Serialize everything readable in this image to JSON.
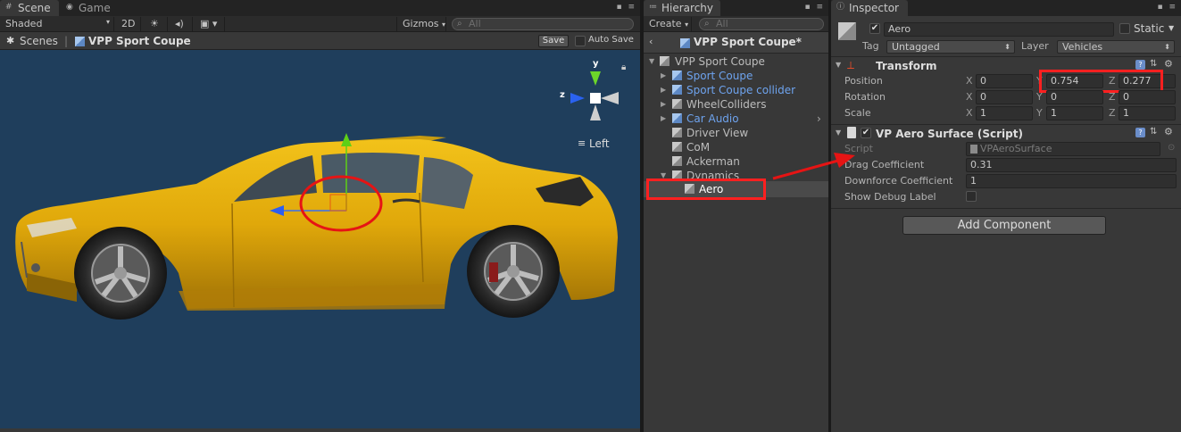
{
  "scene": {
    "tabs": [
      {
        "label": "Scene"
      },
      {
        "label": "Game"
      }
    ],
    "toolbar": {
      "shading": "Shaded",
      "mode_2d": "2D",
      "gizmos": "Gizmos",
      "search_placeholder": "All"
    },
    "breadcrumb": {
      "scenes": "Scenes",
      "object": "VPP Sport Coupe",
      "save": "Save",
      "autosave": "Auto Save"
    },
    "gizmo": {
      "y": "y",
      "z": "z",
      "view": "Left"
    }
  },
  "hierarchy": {
    "tab": "Hierarchy",
    "create": "Create",
    "search_placeholder": "All",
    "header": "VPP Sport Coupe*",
    "items": [
      {
        "label": "VPP Sport Coupe"
      },
      {
        "label": "Sport Coupe"
      },
      {
        "label": "Sport Coupe collider"
      },
      {
        "label": "WheelColliders"
      },
      {
        "label": "Car Audio"
      },
      {
        "label": "Driver View"
      },
      {
        "label": "CoM"
      },
      {
        "label": "Ackerman"
      },
      {
        "label": "Dynamics"
      },
      {
        "label": "Aero"
      }
    ]
  },
  "inspector": {
    "tab": "Inspector",
    "object_name": "Aero",
    "static_label": "Static",
    "tag_label": "Tag",
    "tag_value": "Untagged",
    "layer_label": "Layer",
    "layer_value": "Vehicles",
    "transform": {
      "title": "Transform",
      "position": {
        "label": "Position",
        "x": "0",
        "y": "0.754",
        "z": "0.277"
      },
      "rotation": {
        "label": "Rotation",
        "x": "0",
        "y": "0",
        "z": "0"
      },
      "scale": {
        "label": "Scale",
        "x": "1",
        "y": "1",
        "z": "1"
      }
    },
    "script": {
      "title": "VP Aero Surface (Script)",
      "script_label": "Script",
      "script_value": "VPAeroSurface",
      "drag_label": "Drag Coefficient",
      "drag_value": "0.31",
      "downforce_label": "Downforce Coefficient",
      "downforce_value": "1",
      "debug_label": "Show Debug Label"
    },
    "add_component": "Add Component",
    "axes": {
      "x": "X",
      "y": "Y",
      "z": "Z"
    }
  }
}
